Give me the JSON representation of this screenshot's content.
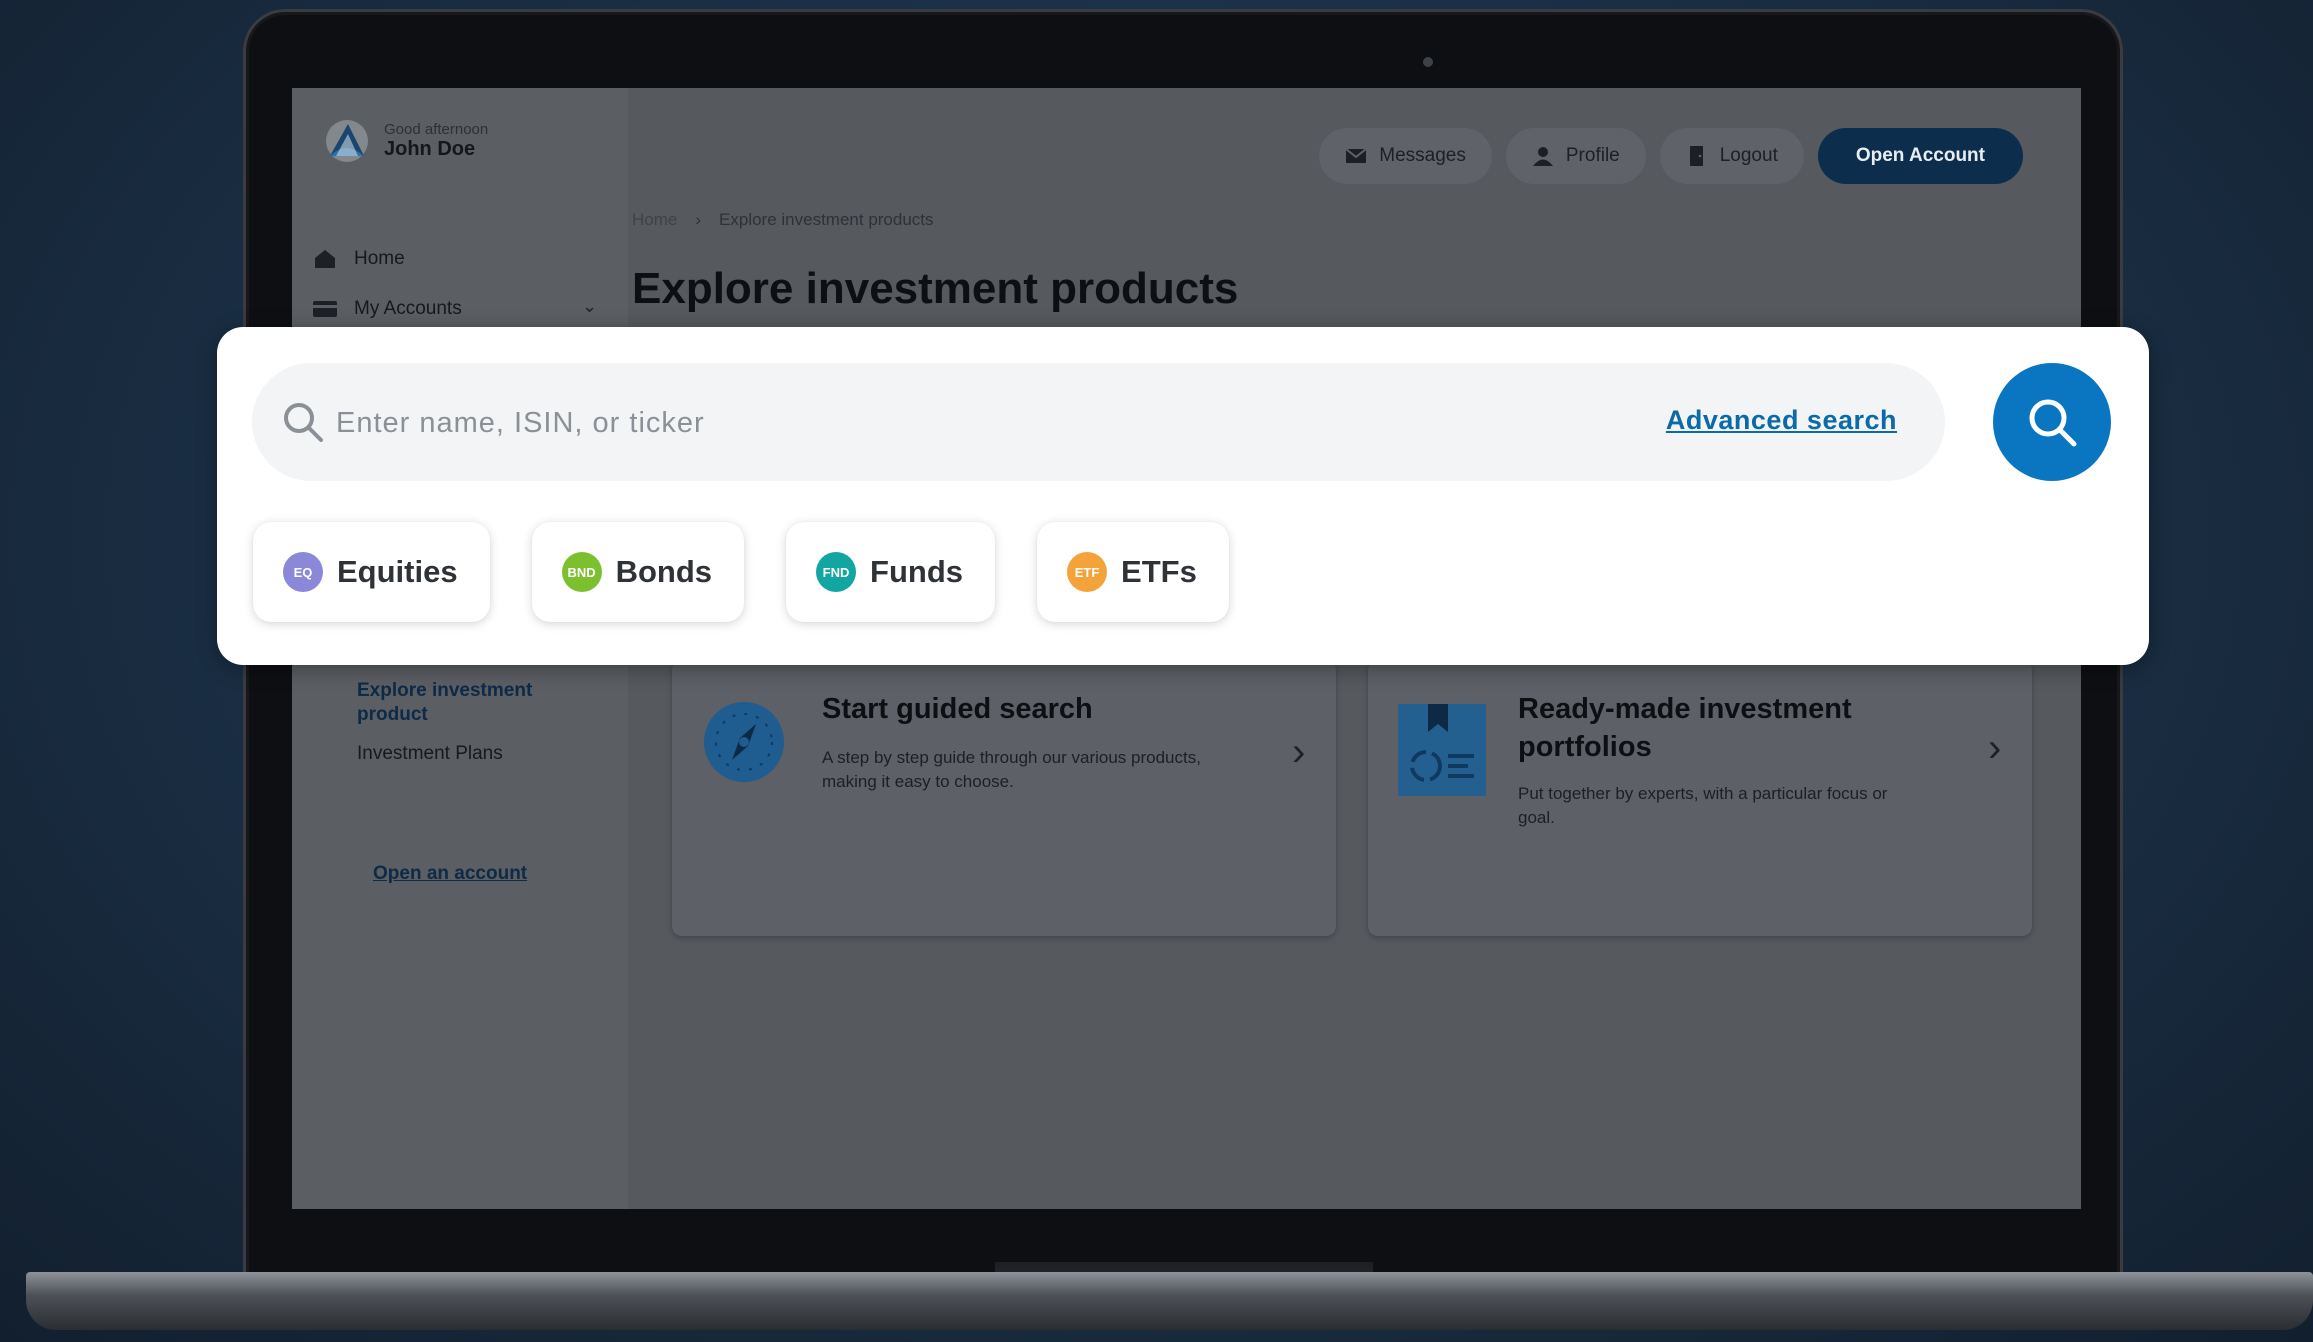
{
  "greeting": {
    "salutation": "Good afternoon",
    "name": "John Doe"
  },
  "sidebar": {
    "items": [
      {
        "label": "Home",
        "icon": "home-icon"
      },
      {
        "label": "My Accounts",
        "icon": "accounts-icon"
      }
    ],
    "sub_active": "Explore investment product",
    "sub_item": "Investment Plans",
    "open_link": "Open an account"
  },
  "topbar": {
    "messages": "Messages",
    "profile": "Profile",
    "logout": "Logout",
    "open_account": "Open Account"
  },
  "breadcrumb": {
    "home": "Home",
    "current": "Explore investment products"
  },
  "page_title": "Explore investment products",
  "search": {
    "placeholder": "Enter name, ISIN, or ticker",
    "advanced": "Advanced search"
  },
  "chips": [
    {
      "badge": "EQ",
      "label": "Equities",
      "color": "#8b87d9"
    },
    {
      "badge": "BND",
      "label": "Bonds",
      "color": "#7cc02f"
    },
    {
      "badge": "FND",
      "label": "Funds",
      "color": "#12a5a1"
    },
    {
      "badge": "ETF",
      "label": "ETFs",
      "color": "#f4a23a"
    }
  ],
  "cards": [
    {
      "title": "Start guided search",
      "desc": "A step by step guide through our various products, making it easy to choose."
    },
    {
      "title": "Ready-made investment portfolios",
      "desc": "Put together by experts, with a particular focus or goal."
    }
  ],
  "colors": {
    "accent": "#0a76c2",
    "link": "#0b6aa8",
    "dark_button": "#0d2d4d"
  }
}
